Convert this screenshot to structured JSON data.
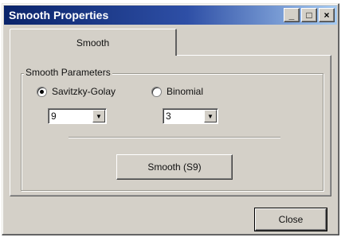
{
  "window": {
    "title": "Smooth Properties",
    "controls": {
      "minimize_glyph": "_",
      "maximize_glyph": "□",
      "close_glyph": "×"
    }
  },
  "tabs": [
    {
      "label": "Smooth",
      "selected": true
    }
  ],
  "group": {
    "legend": "Smooth Parameters",
    "options": [
      {
        "label": "Savitzky-Golay",
        "checked": true,
        "select_value": "9"
      },
      {
        "label": "Binomial",
        "checked": false,
        "select_value": "3"
      }
    ]
  },
  "smooth_button": {
    "label": "Smooth (S9)"
  },
  "footer": {
    "close_label": "Close"
  }
}
